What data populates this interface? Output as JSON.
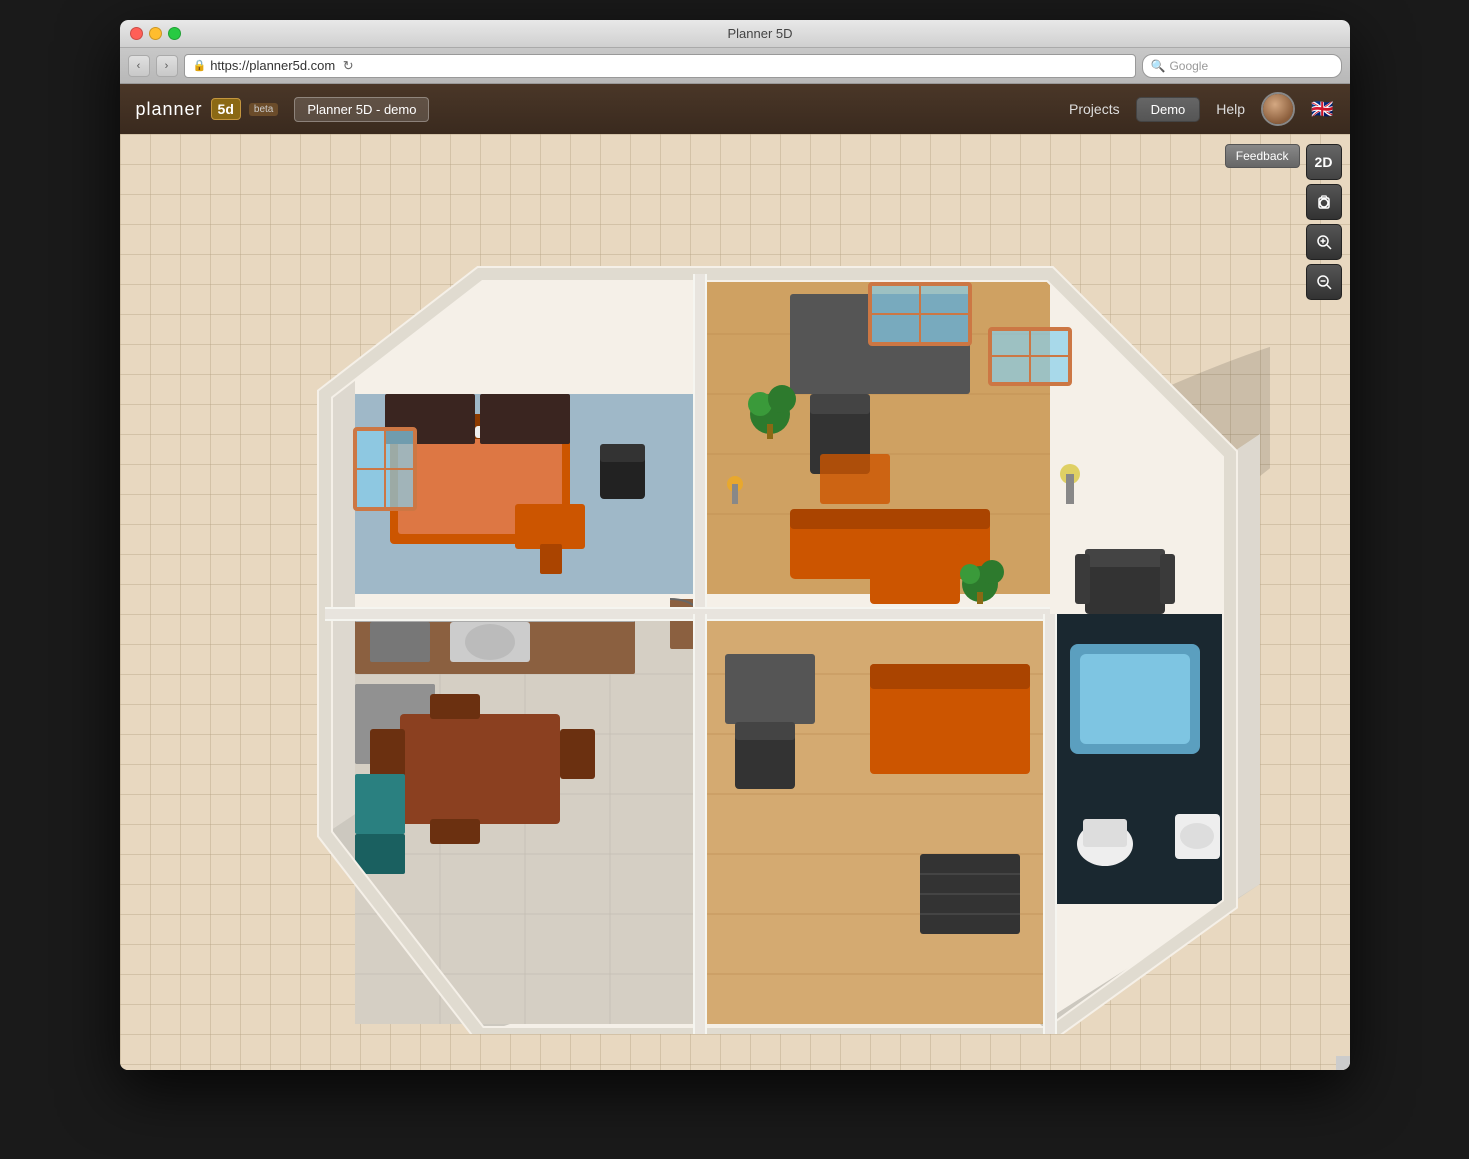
{
  "window": {
    "title": "Planner 5D",
    "controls": {
      "close": "close",
      "minimize": "minimize",
      "maximize": "maximize"
    }
  },
  "browser": {
    "url": "https://planner5d.com",
    "search_placeholder": "Google",
    "back_label": "‹",
    "forward_label": "›",
    "refresh_label": "↻"
  },
  "header": {
    "logo_text": "planner",
    "logo_5d": "5d",
    "beta_label": "beta",
    "project_name": "Planner 5D - demo",
    "nav_items": [
      {
        "label": "Projects",
        "key": "projects"
      },
      {
        "label": "Demo",
        "key": "demo"
      },
      {
        "label": "Help",
        "key": "help"
      }
    ],
    "flag": "🇬🇧"
  },
  "toolbar": {
    "feedback_label": "Feedback",
    "tool_2d": "2D",
    "tool_camera": "📷",
    "tool_zoom_in": "🔍+",
    "tool_zoom_out": "🔍-"
  },
  "floorplan": {
    "view_mode": "3D",
    "description": "3D isometric view of apartment floor plan with multiple rooms"
  },
  "colors": {
    "header_bg": "#3a2a1e",
    "grid_bg": "#e8d8c0",
    "wall_color": "#f0ede8",
    "floor_wood": "#c8934a",
    "floor_tile": "#d8d0c0",
    "floor_blue": "#6baed6",
    "accent_orange": "#cc5500",
    "accent_teal": "#2a8080"
  }
}
